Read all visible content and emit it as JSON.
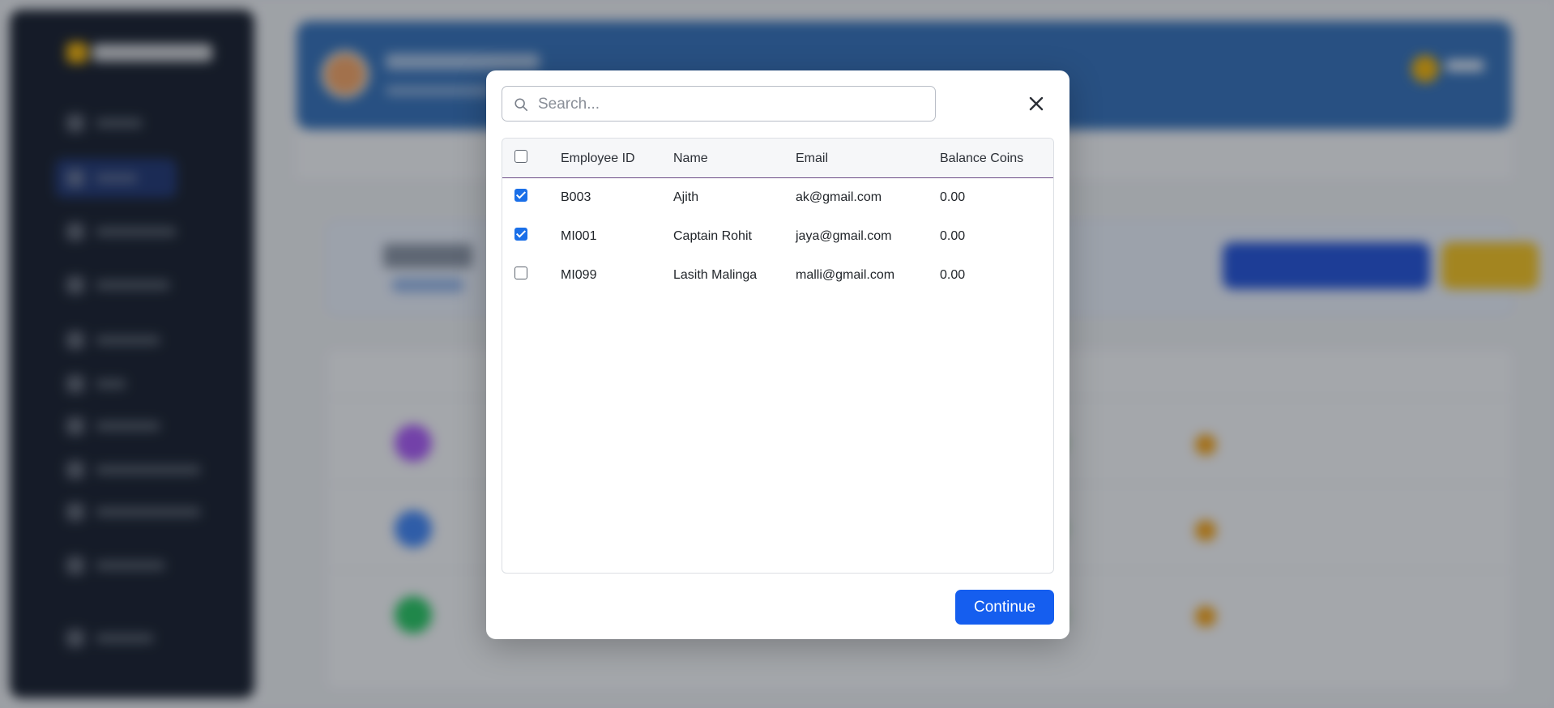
{
  "modal": {
    "search": {
      "placeholder": "Search...",
      "value": ""
    },
    "close_icon": "close-icon",
    "columns": [
      "Employee ID",
      "Name",
      "Email",
      "Balance Coins"
    ],
    "select_all_checked": false,
    "rows": [
      {
        "checked": true,
        "employee_id": "B003",
        "name": "Ajith",
        "email": "ak@gmail.com",
        "balance": "0.00"
      },
      {
        "checked": true,
        "employee_id": "MI001",
        "name": "Captain Rohit",
        "email": "jaya@gmail.com",
        "balance": "0.00"
      },
      {
        "checked": false,
        "employee_id": "MI099",
        "name": "Lasith Malinga",
        "email": "malli@gmail.com",
        "balance": "0.00"
      }
    ],
    "continue_label": "Continue"
  },
  "colors": {
    "primary": "#155eef",
    "checkbox_checked": "#1a6fe8",
    "header_underline": "#6b4b86",
    "overlay": "rgba(30,34,42,0.38)",
    "sidebar": "#111827",
    "hero": "#2f6db8"
  }
}
